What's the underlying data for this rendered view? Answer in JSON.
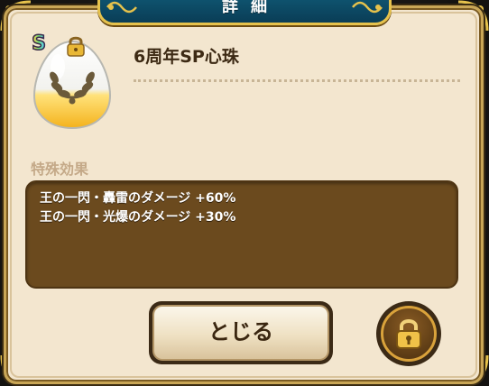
{
  "dialog": {
    "title": "詳細"
  },
  "item": {
    "rank": "S",
    "name": "6周年SP心珠",
    "icon": "laurel-egg-icon",
    "locked": true
  },
  "effects": {
    "label": "特殊効果",
    "lines": [
      "王の一閃・轟雷のダメージ +60%",
      "王の一閃・光爆のダメージ +30%"
    ]
  },
  "buttons": {
    "close_label": "とじる",
    "lock_icon": "padlock-icon"
  },
  "colors": {
    "panel_bg": "#f3e6cf",
    "title_plate": "#0f5773",
    "effects_bg": "#6b4a1e",
    "gold_border": "#c9a656"
  }
}
